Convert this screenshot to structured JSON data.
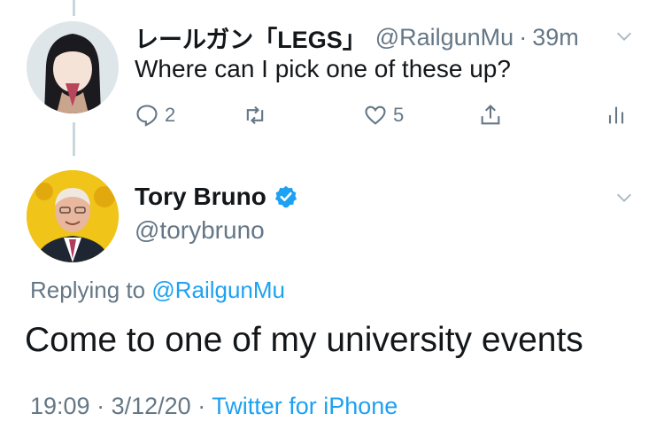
{
  "reply_tweet": {
    "display_name": "レールガン「LEGS」",
    "handle": "@RailgunMu",
    "time": "39m",
    "text": "Where can I pick one of these up?",
    "reply_count": "2",
    "like_count": "5"
  },
  "main_tweet": {
    "author_name": "Tory Bruno",
    "author_handle": "@torybruno",
    "replying_prefix": "Replying to",
    "replying_handle": "@RailgunMu",
    "text": "Come to one of my university events",
    "time": "19:09",
    "date": "3/12/20",
    "source": "Twitter for iPhone"
  },
  "colors": {
    "link": "#1da1f2",
    "secondary_text": "#657786",
    "primary_text": "#14171a",
    "thread_line": "#ccd6dd"
  },
  "icons": {
    "reply": "reply-icon",
    "retweet": "retweet-icon",
    "like": "heart-icon",
    "share": "share-icon",
    "analytics": "analytics-icon",
    "menu": "chevron-down-icon",
    "verified": "verified-badge-icon"
  }
}
